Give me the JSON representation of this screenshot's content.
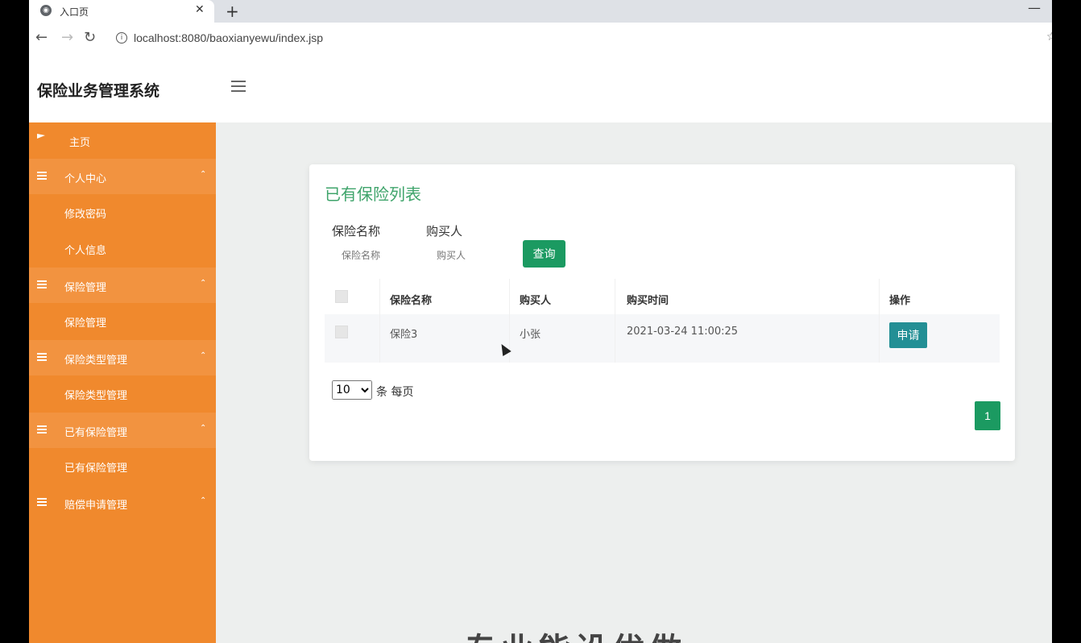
{
  "browser": {
    "tab_title": "入口页",
    "tab_close": "✕",
    "new_tab": "+",
    "minimize": "—",
    "url": "localhost:8080/baoxianyewu/index.jsp",
    "back": "←",
    "forward": "→",
    "reload": "↻",
    "info": "i",
    "star": "☆"
  },
  "app": {
    "title": "保险业务管理系统"
  },
  "sidebar": {
    "items": [
      {
        "label": "主页"
      },
      {
        "label": "个人中心"
      },
      {
        "label": "修改密码"
      },
      {
        "label": "个人信息"
      },
      {
        "label": "保险管理"
      },
      {
        "label": "保险管理"
      },
      {
        "label": "保险类型管理"
      },
      {
        "label": "保险类型管理"
      },
      {
        "label": "已有保险管理"
      },
      {
        "label": "已有保险管理"
      },
      {
        "label": "赔偿申请管理"
      }
    ],
    "caret": "⌃"
  },
  "main": {
    "card_title": "已有保险列表",
    "search": {
      "name_label": "保险名称",
      "name_placeholder": "保险名称",
      "buyer_label": "购买人",
      "buyer_placeholder": "购买人",
      "query_button": "查询"
    },
    "table": {
      "headers": [
        "保险名称",
        "购买人",
        "购买时间",
        "操作"
      ],
      "rows": [
        {
          "name": "保险3",
          "buyer": "小张",
          "time": "2021-03-24 11:00:25",
          "action": "申请"
        }
      ]
    },
    "pagination": {
      "page_size": "10",
      "per_page_text": "条 每页",
      "current_page": "1"
    },
    "banner_text": "专业能设优做"
  }
}
